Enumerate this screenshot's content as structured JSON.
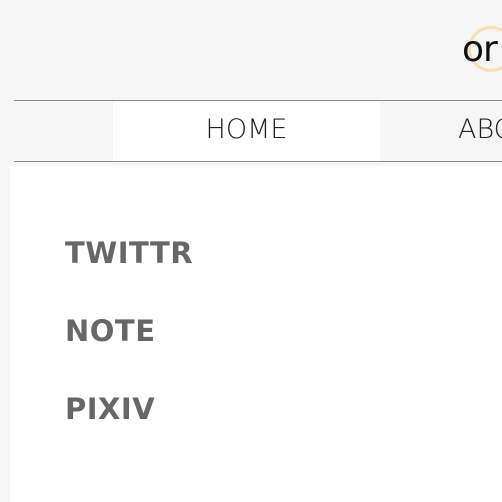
{
  "header": {
    "logo_text": "or"
  },
  "nav": {
    "items": [
      {
        "label": "HOME"
      },
      {
        "label": "ABOUT"
      }
    ]
  },
  "main": {
    "links": [
      {
        "label": "TWITTR"
      },
      {
        "label": "NOTE"
      },
      {
        "label": "PIXIV"
      }
    ]
  },
  "colors": {
    "page_background": "#f6f6f6",
    "panel_background": "#ffffff",
    "link_text": "#676767",
    "nav_text": "#222222",
    "divider": "#8c8c8c",
    "logo_ring": "#f7e0b6"
  }
}
